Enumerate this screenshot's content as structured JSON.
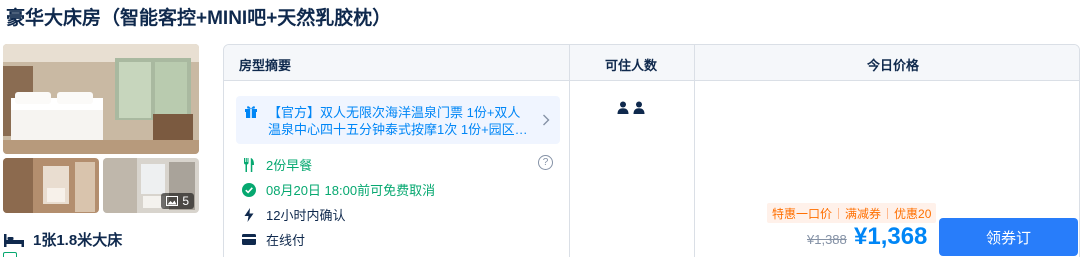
{
  "room": {
    "title": "豪华大床房（智能客控+MINI吧+天然乳胶枕）",
    "photo_count": "5",
    "bed": "1张1.8米大床"
  },
  "table": {
    "headers": {
      "summary": "房型摘要",
      "occupancy": "可住人数",
      "price": "今日价格"
    }
  },
  "rate": {
    "perk_line1": "【官方】双人无限次海洋温泉门票 1份+双人",
    "perk_line2": "温泉中心四十五分钟泰式按摩1次 1份+园区…",
    "breakfast": "2份早餐",
    "cancel": "08月20日 18:00前可免费取消",
    "confirm": "12小时内确认",
    "payment": "在线付",
    "promo_tags": [
      "特惠一口价",
      "满减券",
      "优惠20"
    ],
    "old_price": "¥1,388",
    "price": "¥1,368",
    "book_label": "领券订",
    "guests": 2
  },
  "icons": {
    "bed": "bed-icon",
    "gift": "gift-icon",
    "breakfast": "fork-knife-icon",
    "cancel": "check-circle-icon",
    "confirm": "lightning-icon",
    "payment": "card-icon",
    "help": "question-circle-icon",
    "chevron": "chevron-right-icon",
    "person": "person-icon",
    "photos": "image-icon"
  },
  "colors": {
    "primary_blue": "#0086f6",
    "button_blue": "#287dfa",
    "green": "#06a870",
    "promo_orange": "#ff6f00",
    "text_dark": "#0f294d"
  }
}
